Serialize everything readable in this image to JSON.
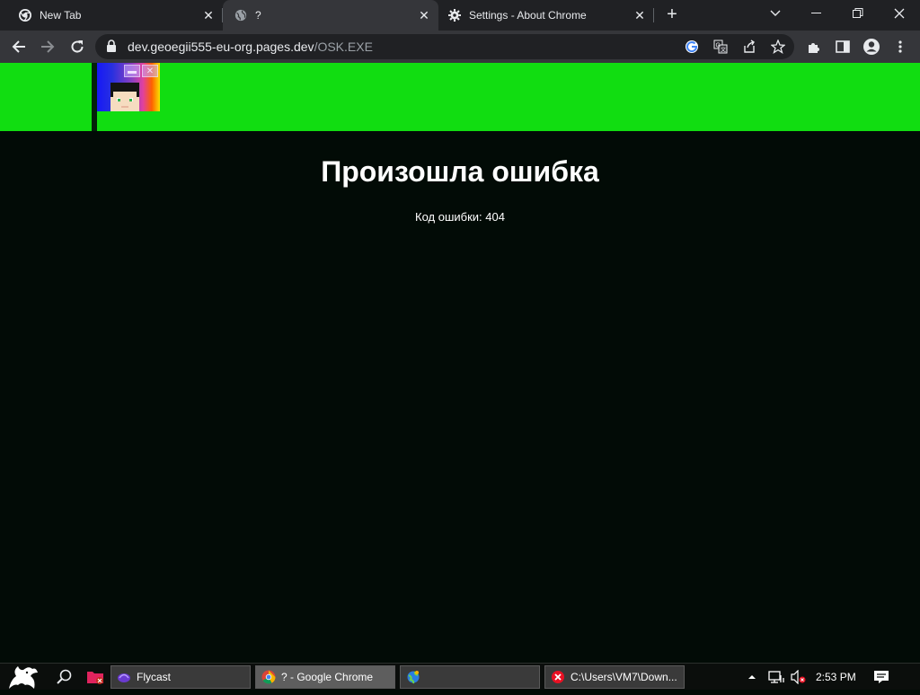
{
  "browser": {
    "tabs": [
      {
        "title": "New Tab",
        "icon": "chrome-icon",
        "active": false
      },
      {
        "title": "?",
        "icon": "globe-icon",
        "active": true
      },
      {
        "title": "Settings - About Chrome",
        "icon": "settings-gear-icon",
        "active": false
      }
    ],
    "new_tab_label": "+",
    "url_host": "dev.geoegii555-eu-org.pages.dev",
    "url_path": "/OSK.EXE"
  },
  "page": {
    "banner_color": "#11dd11",
    "background_color": "#020b06",
    "heading": "Произошла ошибка",
    "error_code_text": "Код ошибки: 404"
  },
  "taskbar": {
    "tasks": [
      {
        "label": "Flycast",
        "icon": "flycast-icon"
      },
      {
        "label": "? - Google Chrome",
        "icon": "chrome-icon"
      },
      {
        "label": "",
        "icon": "network-globe-icon"
      },
      {
        "label": "C:\\Users\\VM7\\Down...",
        "icon": "error-icon"
      }
    ],
    "clock": "2:53 PM"
  }
}
